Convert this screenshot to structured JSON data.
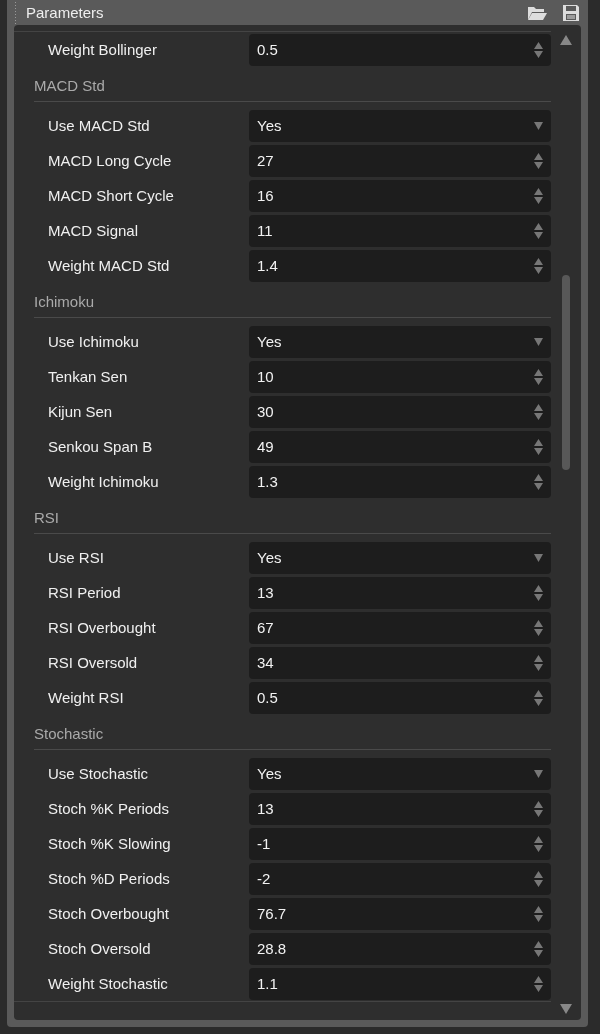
{
  "panel": {
    "title": "Parameters"
  },
  "top_row": {
    "label": "Weight Bollinger",
    "kind": "number",
    "value": "0.5"
  },
  "sections": [
    {
      "title": "MACD Std",
      "rows": [
        {
          "label": "Use MACD Std",
          "kind": "select",
          "value": "Yes"
        },
        {
          "label": "MACD Long Cycle",
          "kind": "number",
          "value": "27"
        },
        {
          "label": "MACD Short Cycle",
          "kind": "number",
          "value": "16"
        },
        {
          "label": "MACD Signal",
          "kind": "number",
          "value": "11"
        },
        {
          "label": "Weight MACD Std",
          "kind": "number",
          "value": "1.4"
        }
      ]
    },
    {
      "title": "Ichimoku",
      "rows": [
        {
          "label": "Use Ichimoku",
          "kind": "select",
          "value": "Yes"
        },
        {
          "label": "Tenkan Sen",
          "kind": "number",
          "value": "10"
        },
        {
          "label": "Kijun Sen",
          "kind": "number",
          "value": "30"
        },
        {
          "label": "Senkou Span B",
          "kind": "number",
          "value": "49"
        },
        {
          "label": "Weight Ichimoku",
          "kind": "number",
          "value": "1.3"
        }
      ]
    },
    {
      "title": "RSI",
      "rows": [
        {
          "label": "Use RSI",
          "kind": "select",
          "value": "Yes"
        },
        {
          "label": "RSI Period",
          "kind": "number",
          "value": "13"
        },
        {
          "label": "RSI Overbought",
          "kind": "number",
          "value": "67"
        },
        {
          "label": "RSI Oversold",
          "kind": "number",
          "value": "34"
        },
        {
          "label": "Weight RSI",
          "kind": "number",
          "value": "0.5"
        }
      ]
    },
    {
      "title": "Stochastic",
      "rows": [
        {
          "label": "Use Stochastic",
          "kind": "select",
          "value": "Yes"
        },
        {
          "label": "Stoch %K Periods",
          "kind": "number",
          "value": "13"
        },
        {
          "label": "Stoch %K Slowing",
          "kind": "number",
          "value": "-1"
        },
        {
          "label": "Stoch %D Periods",
          "kind": "number",
          "value": "-2"
        },
        {
          "label": "Stoch Overbought",
          "kind": "number",
          "value": "76.7"
        },
        {
          "label": "Stoch Oversold",
          "kind": "number",
          "value": "28.8"
        },
        {
          "label": "Weight Stochastic",
          "kind": "number",
          "value": "1.1"
        }
      ]
    }
  ]
}
